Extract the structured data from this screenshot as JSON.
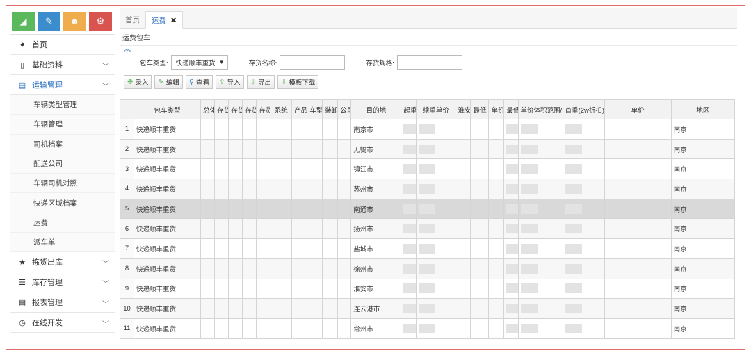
{
  "sidebar": {
    "menu": [
      {
        "label": "首页",
        "icon": "dashboard-icon"
      },
      {
        "label": "基础资料",
        "icon": "file-icon"
      },
      {
        "label": "运输管理",
        "icon": "table-icon"
      }
    ],
    "submenu": [
      "车辆类型管理",
      "车辆管理",
      "司机档案",
      "配送公司",
      "车辆司机对照",
      "快递区域档案",
      "运费",
      "派车单"
    ],
    "menu_bottom": [
      {
        "label": "拣货出库",
        "icon": "star-icon"
      },
      {
        "label": "库存管理",
        "icon": "list-icon"
      },
      {
        "label": "报表管理",
        "icon": "table-icon"
      },
      {
        "label": "在线开发",
        "icon": "clock-icon"
      }
    ]
  },
  "tabs": {
    "home": "首页",
    "active": "运费",
    "close": "✖"
  },
  "page": {
    "section_title": "运费包车",
    "collapse": "︽"
  },
  "filters": {
    "type_label": "包车类型:",
    "type_value": "快递顺丰重货",
    "name_label": "存货名称:",
    "spec_label": "存货规格:"
  },
  "toolbar": {
    "add": "录入",
    "edit": "编辑",
    "view": "查看",
    "import": "导入",
    "export": "导出",
    "template": "模板下载"
  },
  "table": {
    "headers": [
      "包车类型",
      "总体",
      "存货",
      "存货",
      "存货",
      "存货",
      "系统",
      "产品",
      "车型",
      "装卸",
      "公里",
      "目的地",
      "起重",
      "续重单价",
      "淮安",
      "最低",
      "单价",
      "最低",
      "单价体积范围/",
      "首重(2w折扣)",
      "单价",
      "地区"
    ],
    "rows": [
      {
        "n": "1",
        "type": "快递顺丰重货",
        "dest": "南京市",
        "region": "南京"
      },
      {
        "n": "2",
        "type": "快递顺丰重货",
        "dest": "无锡市",
        "region": "南京"
      },
      {
        "n": "3",
        "type": "快递顺丰重货",
        "dest": "镇江市",
        "region": "南京"
      },
      {
        "n": "4",
        "type": "快递顺丰重货",
        "dest": "苏州市",
        "region": "南京"
      },
      {
        "n": "5",
        "type": "快递顺丰重货",
        "dest": "南通市",
        "region": "南京"
      },
      {
        "n": "6",
        "type": "快递顺丰重货",
        "dest": "扬州市",
        "region": "南京"
      },
      {
        "n": "7",
        "type": "快递顺丰重货",
        "dest": "盐城市",
        "region": "南京"
      },
      {
        "n": "8",
        "type": "快递顺丰重货",
        "dest": "徐州市",
        "region": "南京"
      },
      {
        "n": "9",
        "type": "快递顺丰重货",
        "dest": "淮安市",
        "region": "南京"
      },
      {
        "n": "10",
        "type": "快递顺丰重货",
        "dest": "连云港市",
        "region": "南京"
      },
      {
        "n": "11",
        "type": "快递顺丰重货",
        "dest": "常州市",
        "region": "南京"
      }
    ]
  },
  "colors": {
    "green": "#5cb85c",
    "blue": "#3c8dcd",
    "orange": "#f0ad4e",
    "red": "#d9534f",
    "accent": "#2a6ebd"
  }
}
